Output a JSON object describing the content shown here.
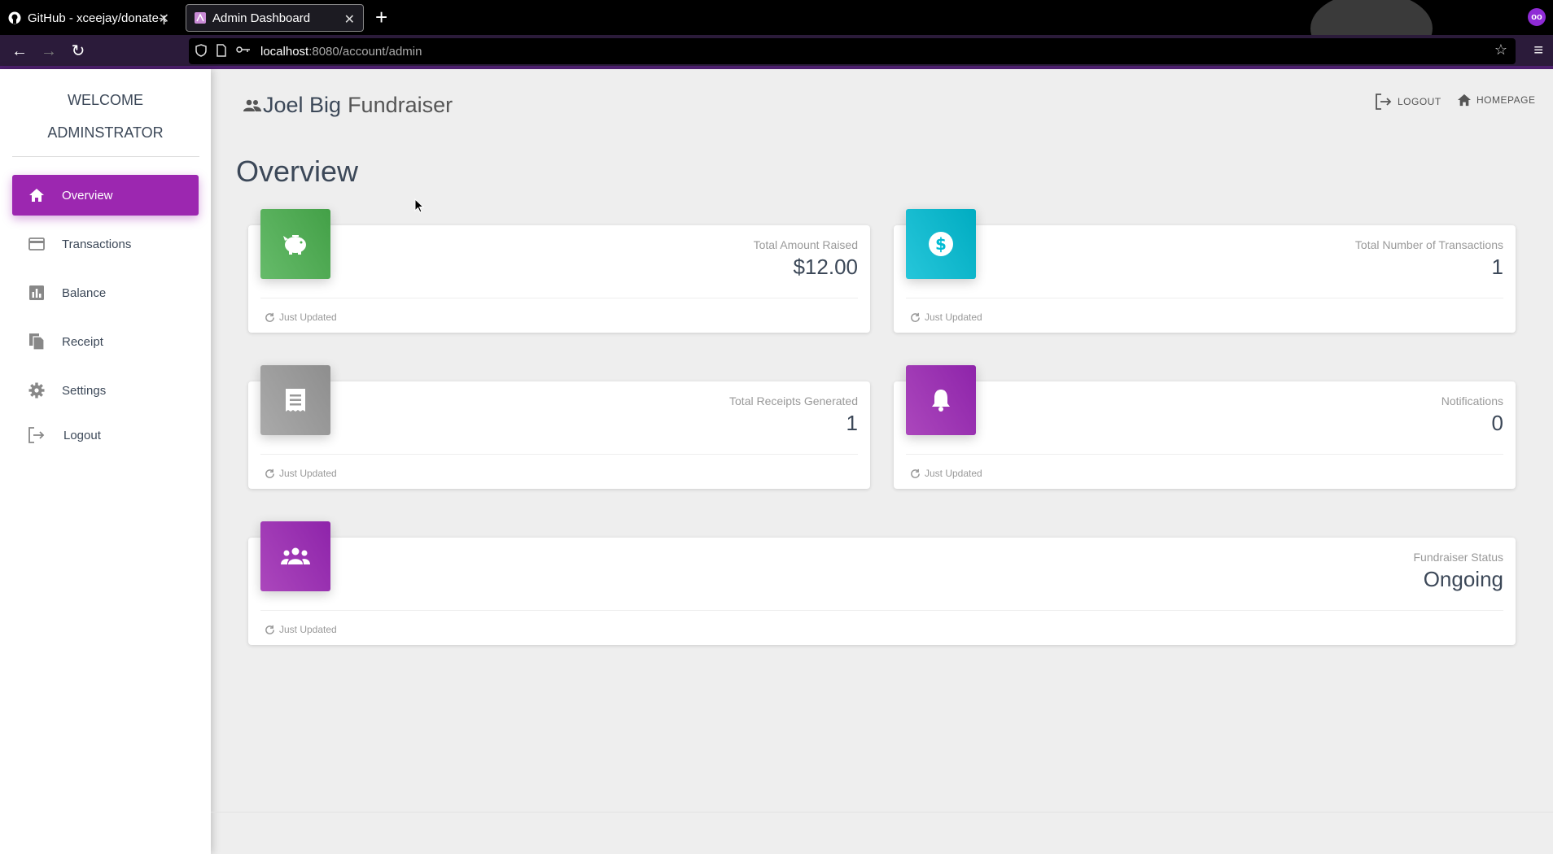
{
  "browser": {
    "tabs": [
      {
        "title": "GitHub - xceejay/donate-pa",
        "active": false
      },
      {
        "title": "Admin Dashboard",
        "active": true
      }
    ],
    "url_host": "localhost",
    "url_rest": ":8080/account/admin"
  },
  "sidebar": {
    "welcome_line1": "WELCOME",
    "welcome_line2": "ADMINSTRATOR",
    "items": [
      {
        "label": "Overview",
        "icon": "home-icon",
        "active": true
      },
      {
        "label": "Transactions",
        "icon": "credit-card-icon",
        "active": false
      },
      {
        "label": "Balance",
        "icon": "bar-chart-icon",
        "active": false
      },
      {
        "label": "Receipt",
        "icon": "documents-icon",
        "active": false
      },
      {
        "label": "Settings",
        "icon": "gear-icon",
        "active": false
      },
      {
        "label": "Logout",
        "icon": "logout-icon",
        "active": false
      }
    ]
  },
  "header": {
    "brand_bold": "Joel Big",
    "brand_light": "Fundraiser",
    "logout_label": "LOGOUT",
    "homepage_label": "HOMEPAGE"
  },
  "page_title": "Overview",
  "cards": [
    {
      "category": "Total Amount Raised",
      "value": "$12.00",
      "footer": "Just Updated",
      "icon": "piggy-bank-icon",
      "color": "#4caf50"
    },
    {
      "category": "Total Number of Transactions",
      "value": "1",
      "footer": "Just Updated",
      "icon": "dollar-circle-icon",
      "color": "#00bcd4"
    },
    {
      "category": "Total Receipts Generated",
      "value": "1",
      "footer": "Just Updated",
      "icon": "receipt-icon",
      "color": "#999999"
    },
    {
      "category": "Notifications",
      "value": "0",
      "footer": "Just Updated",
      "icon": "bell-icon",
      "color": "#9c27b0"
    },
    {
      "category": "Fundraiser Status",
      "value": "Ongoing",
      "footer": "Just Updated",
      "icon": "group-icon",
      "color": "#9c27b0"
    }
  ]
}
